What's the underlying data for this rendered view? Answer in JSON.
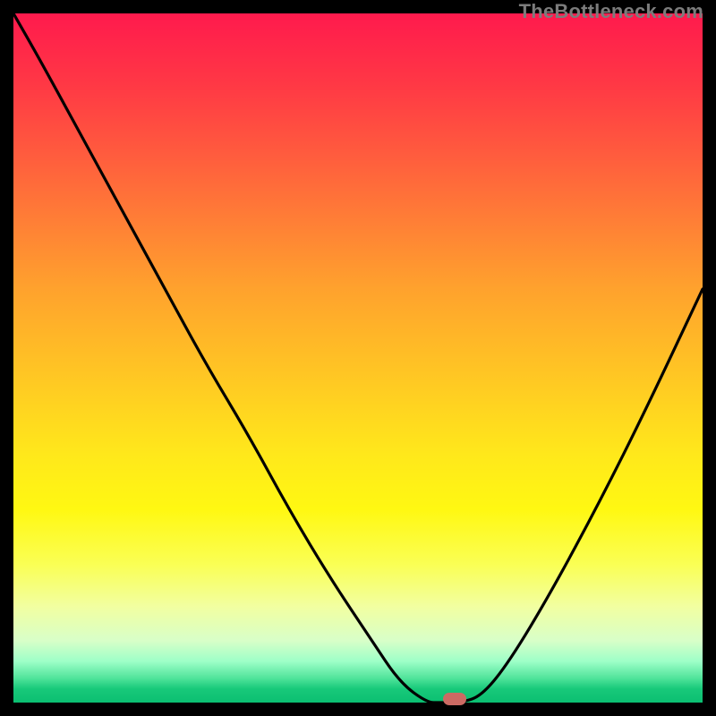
{
  "watermark": "TheBottleneck.com",
  "colors": {
    "gradient_top": "#ff1a4d",
    "gradient_mid": "#ffe81b",
    "gradient_bottom": "#0bbf71",
    "curve": "#000000",
    "marker": "#cc6a63",
    "background": "#000000"
  },
  "chart_data": {
    "type": "line",
    "title": "",
    "xlabel": "",
    "ylabel": "",
    "xlim": [
      0,
      100
    ],
    "ylim": [
      0,
      100
    ],
    "grid": false,
    "note": "Axes are unlabeled; x/y values are relative 0–100 based on plot-area position. y=0 is the baseline (bottom / green), y=100 is the top (red).",
    "series": [
      {
        "name": "bottleneck-curve",
        "x": [
          0,
          4,
          10,
          16,
          22,
          28,
          34,
          40,
          46,
          52,
          56,
          60,
          62,
          65,
          68,
          72,
          78,
          85,
          92,
          100
        ],
        "y": [
          100,
          93,
          82,
          71,
          60,
          49,
          39,
          28,
          18,
          9,
          3,
          0,
          0,
          0,
          1,
          6,
          16,
          29,
          43,
          60
        ]
      }
    ],
    "marker": {
      "name": "optimal-point",
      "x": 64,
      "y": 0.5
    },
    "flat_bottom_range": {
      "x_start": 59,
      "x_end": 66,
      "y": 0
    }
  }
}
